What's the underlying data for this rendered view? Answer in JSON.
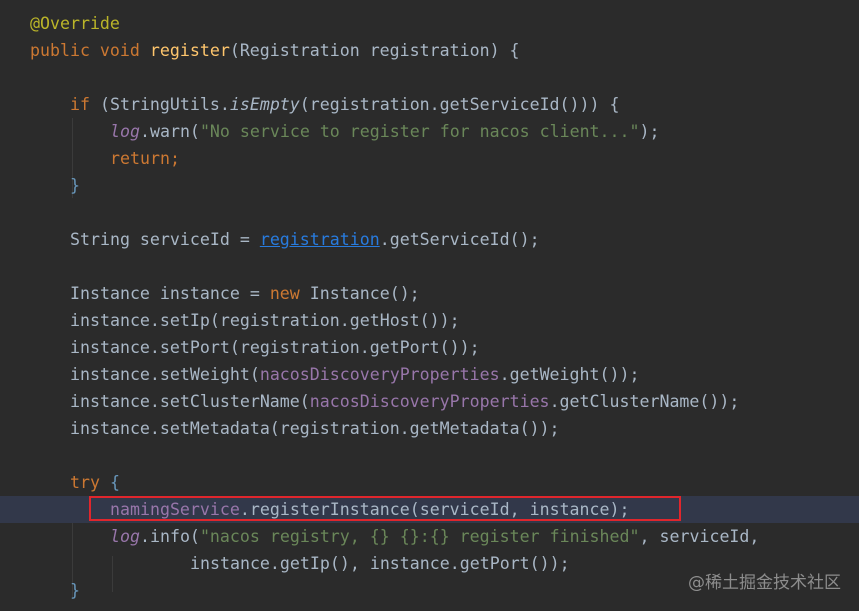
{
  "code": {
    "line_annotation": "@Override",
    "line_signature": {
      "kw1": "public void ",
      "method": "register",
      "params": "(Registration registration) {"
    },
    "if_line": {
      "kw": "if ",
      "a": "(StringUtils.",
      "b": "isEmpty",
      "c": "(registration.getServiceId())) {"
    },
    "warn_line": {
      "a": "log",
      "b": ".warn(",
      "c": "\"No service to register for nacos client...\"",
      "d": ");"
    },
    "return_line": {
      "kw": "return",
      "semi": ";"
    },
    "close_if": "}",
    "serviceid_line": {
      "a": "String serviceId = ",
      "b": "registration",
      "c": ".getServiceId();"
    },
    "instance_line": {
      "a": "Instance instance = ",
      "kw": "new ",
      "b": "Instance();"
    },
    "setip": "instance.setIp(registration.getHost());",
    "setport": "instance.setPort(registration.getPort());",
    "setweight": {
      "a": "instance.setWeight(",
      "b": "nacosDiscoveryProperties",
      "c": ".getWeight());"
    },
    "setcluster": {
      "a": "instance.setClusterName(",
      "b": "nacosDiscoveryProperties",
      "c": ".getClusterName());"
    },
    "setmeta": "instance.setMetadata(registration.getMetadata());",
    "try_line": {
      "kw": "try",
      "brace": " {"
    },
    "naming_line": {
      "a": "namingService",
      "b": ".registerInstance(serviceId, instance);"
    },
    "info_line": {
      "a": "log",
      "b": ".info(",
      "c": "\"nacos registry, {} {}:{} register finished\"",
      "d": ", serviceId,"
    },
    "info_cont": "instance.getIp(), instance.getPort());",
    "close_try": "}"
  },
  "watermark": "@稀土掘金技术社区",
  "colors": {
    "background": "#2b2b2b",
    "keyword": "#cc7832",
    "method": "#ffc66d",
    "string": "#6a8759",
    "field": "#9876aa",
    "annotation": "#bbb529",
    "highlight_box": "#e0262c"
  }
}
